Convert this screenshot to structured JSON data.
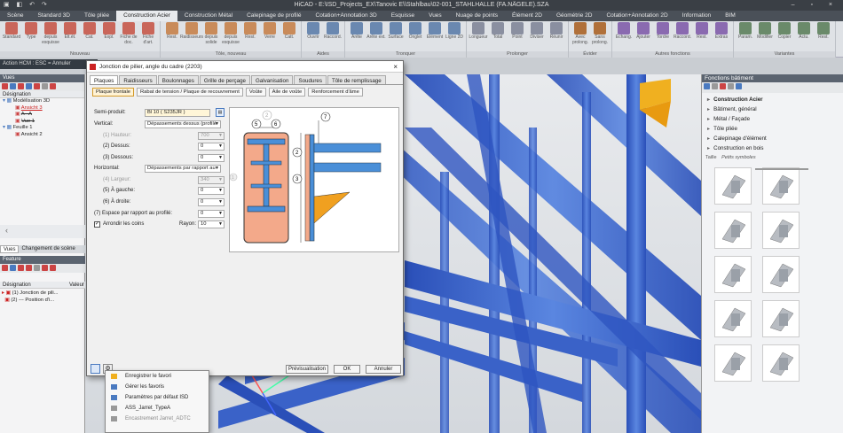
{
  "title": "HiCAD - E:\\ISD_Projects_EX\\Tanovic E\\\\Stahlbau\\02-001_STAHLHALLE (FA.NÄGELE).SZA",
  "window_controls": "– ▫ ×",
  "quick_access": "▣ ◧ ↶ ↷",
  "tabs": [
    "Scène",
    "Standard 3D",
    "Tôle pliée",
    "Construction Acier",
    "Construction Métal",
    "Calepinage de profilé",
    "Cotation+Annotation 3D",
    "Esquisse",
    "Vues",
    "Nuage de points",
    "Élément 2D",
    "Géométrie 2D",
    "Cotation+Annotation 2D",
    "Information",
    "BIM"
  ],
  "ribbon_groups": [
    {
      "name": "Nouveau",
      "buttons": [
        "Standard",
        "Type",
        "depuis esquisse",
        "Élt.ét.",
        "Cat.",
        "Expl.",
        "Fiche de doc.",
        "Fiche d'art."
      ],
      "color": "#c9665a"
    },
    {
      "name": "Tôle, nouveau",
      "buttons": [
        "Rest.",
        "Raidisseurs",
        "depuis solide",
        "depuis esquisse",
        "Rest.",
        "Verre",
        "Catt."
      ],
      "color": "#c98b5a"
    },
    {
      "name": "Aides",
      "buttons": [
        "Ouvrir",
        "Raccord."
      ],
      "color": "#6a88b0"
    },
    {
      "name": "Tronquer",
      "buttons": [
        "Arête",
        "Arête ext.",
        "Surface",
        "Onglet",
        "Élément",
        "Ligne 2D"
      ],
      "color": "#6a88b0"
    },
    {
      "name": "Prolonger",
      "buttons": [
        "Longueur",
        "Total",
        "Point",
        "Diviser",
        "Réunir"
      ],
      "color": "#8a8fa0"
    },
    {
      "name": "Évider",
      "buttons": [
        "Avec prolong.",
        "Sans prolong."
      ],
      "color": "#b0703a"
    },
    {
      "name": "Autres fonctions",
      "buttons": [
        "Échang.",
        "Ajouter",
        "Tordre",
        "Raccord.",
        "Rest.",
        "Extras"
      ],
      "color": "#8a6ab0"
    },
    {
      "name": "Variantes",
      "buttons": [
        "Param.",
        "Modifier",
        "Copier",
        "Actu.",
        "Rest."
      ],
      "color": "#6a8a6a"
    }
  ],
  "action_bar": "Action HCM : ESC = Annuler",
  "left_panel": {
    "vues_header": "Vues",
    "tree_header": "Désignation",
    "tree": [
      {
        "label": "Modélisation 3D",
        "indent": 0,
        "state": "normal"
      },
      {
        "label": "Ansicht 3",
        "indent": 1,
        "state": "active"
      },
      {
        "label": "A - A",
        "indent": 1,
        "state": "strike"
      },
      {
        "label": "Vue 1",
        "indent": 1,
        "state": "strike"
      },
      {
        "label": "Feuille 1",
        "indent": 0,
        "state": "normal"
      },
      {
        "label": "Ansicht 2",
        "indent": 1,
        "state": "normal"
      }
    ],
    "bottom_tabs": [
      "Vues",
      "Changement de scène"
    ],
    "feature_header": "Feature",
    "col_designation": "Désignation",
    "col_valeur": "Valeur",
    "features": [
      "(1) Jonction de pili...",
      "(2) --- Position d'i..."
    ]
  },
  "dialog": {
    "title": "Jonction de pilier, angle du cadre (2203)",
    "close": "×",
    "tabs": [
      "Plaques",
      "Raidisseurs",
      "Boulonnages",
      "Grille de perçage",
      "Galvanisation",
      "Soudures",
      "Tôle de remplissage"
    ],
    "sub_buttons": [
      "Plaque frontale",
      "Rabat de tension / Plaque de recouvrement",
      "Voûte",
      "Aile de voûte",
      "Renforcement d'âme"
    ],
    "fields": {
      "semi_produit_label": "Semi-produit:",
      "semi_produit_value": "Bl 10  ( S235JR )",
      "vertical_label": "Vertical:",
      "vertical_value": "Dépassements dessus (profilé",
      "hauteur_label": "(1) Hauteur:",
      "hauteur_value": "700",
      "dessus_label": "(2) Dessus:",
      "dessus_value": "0",
      "dessous_label": "(3) Dessous:",
      "dessous_value": "0",
      "horizontal_label": "Horizontal:",
      "horizontal_value": "Dépassements par rapport au",
      "largeur_label": "(4) Largeur:",
      "largeur_value": "340",
      "gauche_label": "(5) À gauche:",
      "gauche_value": "0",
      "droite_label": "(6) À droite:",
      "droite_value": "0",
      "espace_label": "(7) Espace par rapport au profilé:",
      "espace_value": "0",
      "arrondir_label": "Arrondir les coins",
      "rayon_label": "Rayon:",
      "rayon_value": "10"
    },
    "diagram_labels": [
      "2",
      "5",
      "6",
      "7",
      "2",
      "3",
      "1"
    ],
    "buttons": {
      "preview": "Prévisualisation",
      "ok": "OK",
      "cancel": "Annuler"
    }
  },
  "context_menu": [
    "Enregistrer le favori",
    "Gérer les favoris",
    "Paramètres par défaut ISD",
    "ASS_Jarret_TypeA",
    "Encastrement Jarret_ADTC"
  ],
  "right_panel": {
    "header": "Fonctions bâtiment",
    "items": [
      "Construction Acier",
      "Bâtiment, général",
      "Métal / Façade",
      "Tôle pliée",
      "Calepinage d'élément",
      "Construction en bois"
    ],
    "size_label": "Taille",
    "size_small": "Petits symboles"
  }
}
